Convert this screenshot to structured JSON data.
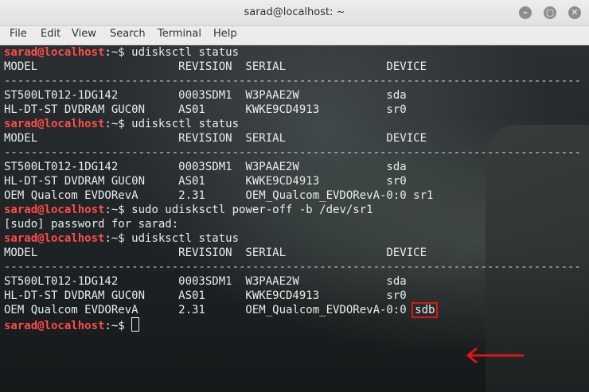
{
  "window": {
    "title": "sarad@localhost: ~",
    "min": "–",
    "max": "▢",
    "close": "✕"
  },
  "menu": {
    "file": "File",
    "edit": "Edit",
    "view": "View",
    "search": "Search",
    "terminal": "Terminal",
    "help": "Help"
  },
  "terminal": {
    "prompt": "sarad@localhost",
    "lines": [
      {
        "type": "cmd",
        "text": ":~$ udisksctl status"
      },
      {
        "type": "out",
        "text": "MODEL                     REVISION  SERIAL               DEVICE"
      },
      {
        "type": "sep",
        "text": "--------------------------------------------------------------------------------------"
      },
      {
        "type": "out",
        "text": "ST500LT012-1DG142         0003SDM1  W3PAAE2W             sda"
      },
      {
        "type": "out",
        "text": "HL-DT-ST DVDRAM GUC0N     AS01      KWKE9CD4913          sr0"
      },
      {
        "type": "cmd",
        "text": ":~$ udisksctl status"
      },
      {
        "type": "out",
        "text": "MODEL                     REVISION  SERIAL               DEVICE"
      },
      {
        "type": "sep",
        "text": "--------------------------------------------------------------------------------------"
      },
      {
        "type": "out",
        "text": "ST500LT012-1DG142         0003SDM1  W3PAAE2W             sda"
      },
      {
        "type": "out",
        "text": "HL-DT-ST DVDRAM GUC0N     AS01      KWKE9CD4913          sr0"
      },
      {
        "type": "out",
        "text": "OEM Qualcom EVDORevA      2.31      OEM_Qualcom_EVDORevA-0:0 sr1"
      },
      {
        "type": "cmd",
        "text": ":~$ sudo udisksctl power-off -b /dev/sr1"
      },
      {
        "type": "out",
        "text": "[sudo] password for sarad:"
      },
      {
        "type": "cmd",
        "text": ":~$ udisksctl status"
      },
      {
        "type": "out",
        "text": "MODEL                     REVISION  SERIAL               DEVICE"
      },
      {
        "type": "sep",
        "text": "--------------------------------------------------------------------------------------"
      },
      {
        "type": "out",
        "text": "ST500LT012-1DG142         0003SDM1  W3PAAE2W             sda"
      },
      {
        "type": "out",
        "text": "HL-DT-ST DVDRAM GUC0N     AS01      KWKE9CD4913          sr0"
      },
      {
        "type": "hl",
        "text": "OEM Qualcom EVDORevA      2.31      OEM_Qualcom_EVDORevA-0:0 ",
        "highlight": "sdb"
      },
      {
        "type": "current",
        "text": ":~$ "
      }
    ]
  },
  "colors": {
    "prompt": "#ff4b4b",
    "highlight": "#e0141a"
  }
}
